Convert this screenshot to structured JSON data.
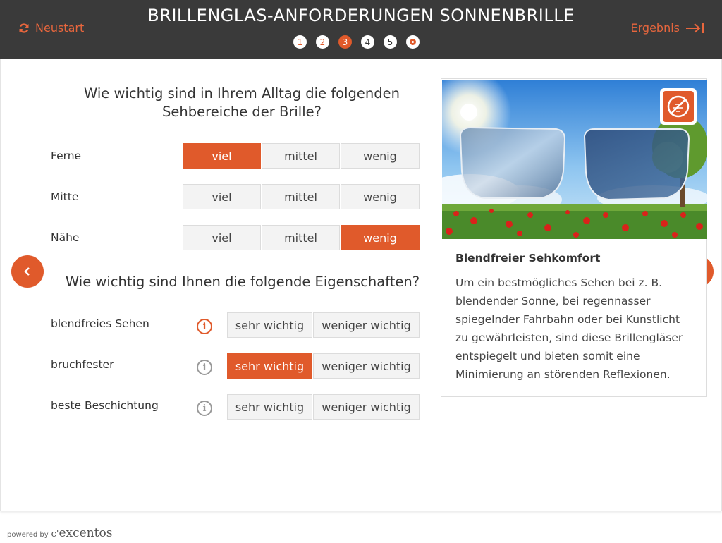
{
  "header": {
    "title": "BRILLENGLAS-ANFORDERUNGEN SONNENBRILLE",
    "restart_label": "Neustart",
    "result_label": "Ergebnis",
    "steps": [
      "1",
      "2",
      "3",
      "4",
      "5"
    ],
    "accent_color": "#e05a2b",
    "background_color": "#3a3a3a"
  },
  "section1": {
    "question": "Wie wichtig sind in Ihrem Alltag die folgenden Sehbereiche der Brille?",
    "options": [
      "viel",
      "mittel",
      "wenig"
    ],
    "rows": [
      {
        "label": "Ferne",
        "selected": "viel"
      },
      {
        "label": "Mitte",
        "selected": null
      },
      {
        "label": "Nähe",
        "selected": "wenig"
      }
    ]
  },
  "section2": {
    "question": "Wie wichtig sind Ihnen die folgende Eigenschaften?",
    "options": [
      "sehr wichtig",
      "weniger wichtig"
    ],
    "rows": [
      {
        "label": "blendfreies Sehen",
        "selected": null,
        "info_active": true
      },
      {
        "label": "bruchfester",
        "selected": "sehr wichtig",
        "info_active": false
      },
      {
        "label": "beste Beschichtung",
        "selected": null,
        "info_active": false
      }
    ]
  },
  "info_card": {
    "title": "Blendfreier Sehkomfort",
    "text": "Um ein bestmögliches Sehen bei z. B. blendender Sonne, bei regennasser spiegelnder Fahrbahn oder bei Kunstlicht zu gewährleisten, sind diese Brillengläser entspiegelt und bieten somit eine Minimierung an störenden Reflexionen.",
    "badge_icon": "no-glare-icon"
  },
  "footer": {
    "powered_by": "powered by",
    "brand": "excentos"
  }
}
